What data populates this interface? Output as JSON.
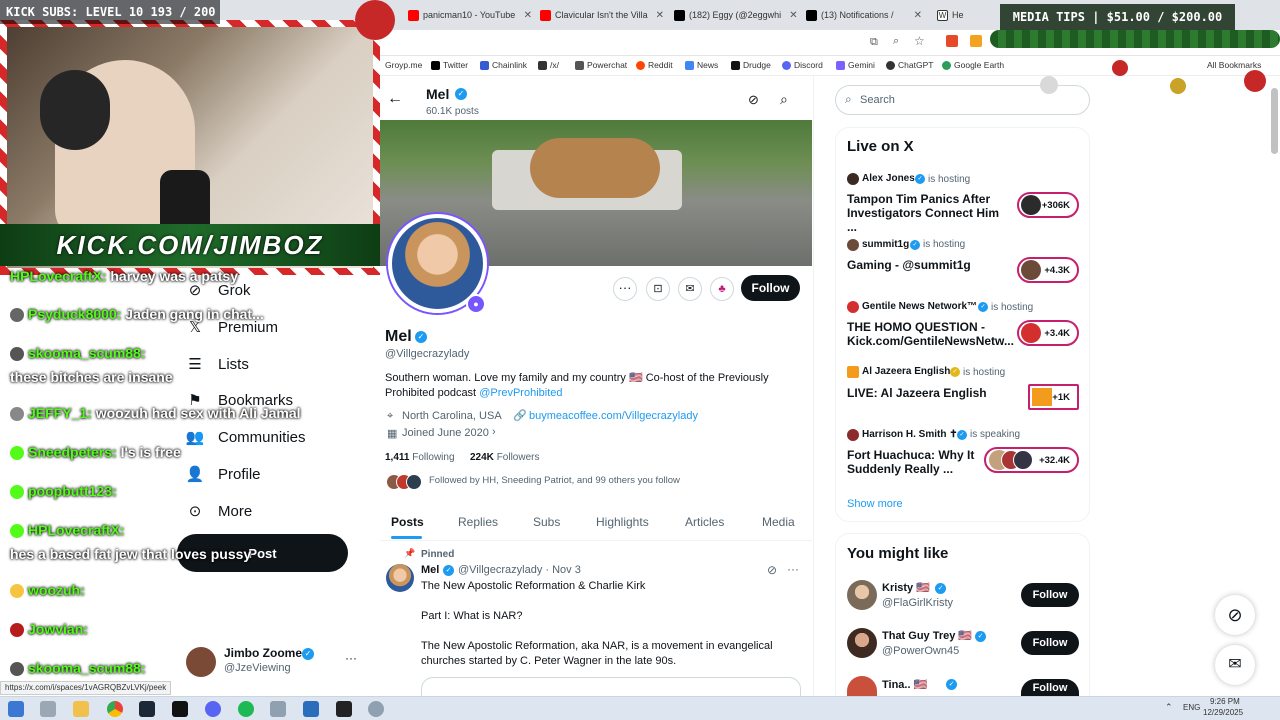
{
  "browser": {
    "tabs": [
      {
        "title": "panicman10 - YouTube",
        "color": "#ff0000"
      },
      {
        "title": "Clavicular Isn't the Villa",
        "color": "#ff0000"
      },
      {
        "title": "(182) Eggy (@2eggwhi",
        "color": "#000000"
      },
      {
        "title": "(13) Notifications /",
        "color": "#000000"
      },
      {
        "title": "He",
        "color": "#444444"
      }
    ],
    "bookmarks": [
      "Groyp.me",
      "Twitter",
      "Chainlink",
      "/x/",
      "Powerchat",
      "Reddit",
      "News",
      "Drudge",
      "Discord",
      "Gemini",
      "ChatGPT",
      "Google Earth",
      "All Bookmarks"
    ],
    "status_url": "https://x.com/i/spaces/1vAGRQBZvLVKj/peek"
  },
  "overlay": {
    "kick_subs": "KICK SUBS: LEVEL 10 193 / 200",
    "media_tips": "MEDIA TIPS | $51.00 / $200.00",
    "banner": "KICK.COM/JIMBOZ",
    "chat": [
      {
        "user": "HPLovecraftX:",
        "msg": "harvey was a patsy"
      },
      {
        "user": "Psyduck8000:",
        "msg": "Jaden gang in chat..."
      },
      {
        "user": "skooma_scum88:",
        "msg": ""
      },
      {
        "user": "",
        "msg": "these bitches are insane"
      },
      {
        "user": "JEFFY_1:",
        "msg": "woozuh had sex with Ali Jamal"
      },
      {
        "user": "Sneedpeters:",
        "msg": "I's is free"
      },
      {
        "user": "poopbutt123:",
        "msg": ""
      },
      {
        "user": "HPLovecraftX:",
        "msg": ""
      },
      {
        "user": "",
        "msg": "hes a based fat jew that loves pussy"
      },
      {
        "user": "woozuh:",
        "msg": ""
      },
      {
        "user": "Jowvian:",
        "msg": ""
      },
      {
        "user": "skooma_scum88:",
        "msg": ""
      }
    ]
  },
  "nav": {
    "items": [
      "Grok",
      "Premium",
      "Lists",
      "Bookmarks",
      "Communities",
      "Profile",
      "More"
    ],
    "post_label": "Post",
    "account_name": "Jimbo Zoomer",
    "account_handle": "@JzeViewing"
  },
  "profile": {
    "header_name": "Mel",
    "post_count": "60.1K posts",
    "name": "Mel",
    "handle": "@Villgecrazylady",
    "bio": "Southern woman. Love my family and my country 🇺🇸 Co-host of the Previously Prohibited podcast",
    "bio_link": "@PrevProhibited",
    "location": "North Carolina, USA",
    "website": "buymeacoffee.com/Villgecrazylady",
    "joined": "Joined June 2020",
    "following_count": "1,411",
    "following_label": "Following",
    "followers_count": "224K",
    "followers_label": "Followers",
    "followed_by": "Followed by HH, Sneeding Patriot, and 99 others you follow",
    "follow_label": "Follow",
    "tabs": [
      "Posts",
      "Replies",
      "Subs",
      "Highlights",
      "Articles",
      "Media"
    ],
    "pinned_label": "Pinned"
  },
  "post": {
    "name": "Mel",
    "handle_date": "@Villgecrazylady · Nov 3",
    "title": "The New Apostolic Reformation & Charlie Kirk",
    "line1": "Part I: What is NAR?",
    "line2": "The New Apostolic Reformation, aka NAR, is a movement in evangelical churches started by C. Peter Wagner in the late 90s."
  },
  "sidebar": {
    "search_placeholder": "Search",
    "live_heading": "Live on X",
    "live": [
      {
        "host": "Alex Jones",
        "status": "is hosting",
        "title": "Tampon Tim Panics After Investigators Connect Him ...",
        "count": "+306K"
      },
      {
        "host": "summit1g",
        "status": "is hosting",
        "title": "Gaming - @summit1g",
        "count": "+4.3K"
      },
      {
        "host": "Gentile News Network™",
        "status": "is hosting",
        "title": "THE HOMO QUESTION - Kick.com/GentileNewsNetw...",
        "count": "+3.4K"
      },
      {
        "host": "Al Jazeera English",
        "status": "is hosting",
        "title": "LIVE: Al Jazeera English",
        "count": "+1K"
      },
      {
        "host": "Harrison H. Smith ✝",
        "status": "is speaking",
        "title": "Fort Huachuca: Why It Suddenly Really ...",
        "count": "+32.4K"
      }
    ],
    "show_more": "Show more",
    "like_heading": "You might like",
    "suggestions": [
      {
        "name": "Kristy 🇺🇸",
        "handle": "@FlaGirlKristy"
      },
      {
        "name": "That Guy Trey 🇺🇸",
        "handle": "@PowerOwn45"
      },
      {
        "name": "Tina.. 🇺🇸",
        "handle": ""
      }
    ],
    "follow_label": "Follow"
  },
  "taskbar": {
    "lang": "ENG",
    "time": "9:26 PM",
    "date": "12/29/2025"
  }
}
